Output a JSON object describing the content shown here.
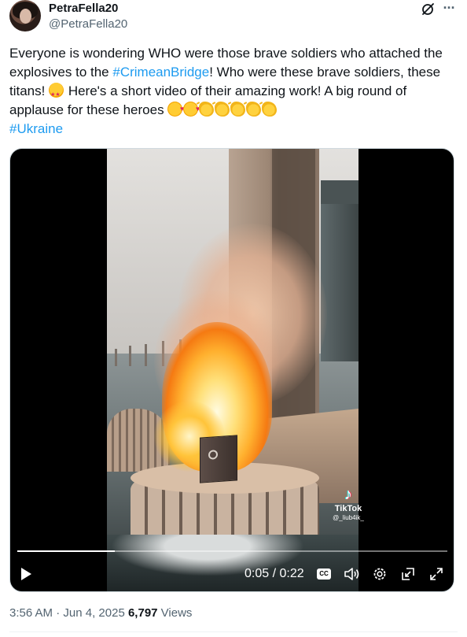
{
  "author": {
    "display_name": "PetraFella20",
    "handle": "@PetraFella20",
    "avatar_icon": "avatar"
  },
  "header_actions": {
    "grok_icon": "grok-icon",
    "more_icon": "more-icon",
    "more_label": "···"
  },
  "tweet": {
    "text_1": "Everyone is wondering WHO were those brave soldiers who attached the explosives to the ",
    "link_crimean": "#CrimeanBridge",
    "text_2": "! Who were these brave soldiers, these titans! ",
    "text_3": " Here's a short video of their amazing work! A big round of applause for these heroes ",
    "link_ukraine": "#Ukraine",
    "link_color": "#1d9bf0"
  },
  "video": {
    "watermark_brand": "TikTok",
    "watermark_user": "@_liub4ik_",
    "current_time": "0:05",
    "separator": " / ",
    "duration": "0:22",
    "progress_fraction": 0.227,
    "cc_label": "CC",
    "controls": [
      "play-icon",
      "cc-icon",
      "volume-icon",
      "settings-icon",
      "pip-icon",
      "fullscreen-icon"
    ]
  },
  "meta": {
    "time": "3:56 AM",
    "dot": " · ",
    "date": "Jun 4, 2025",
    "views_count": "6,797",
    "views_label": " Views"
  }
}
